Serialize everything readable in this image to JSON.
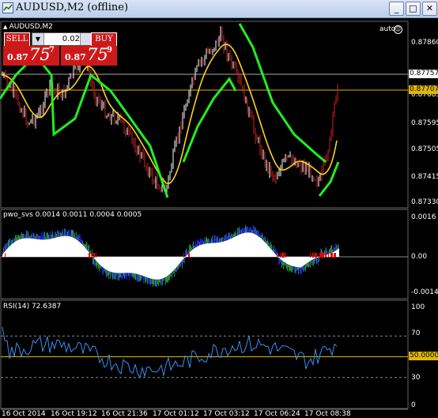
{
  "window": {
    "title": "AUDUSD,M2 (offline)",
    "buttons": [
      "_",
      "□",
      "✕"
    ]
  },
  "main_chart": {
    "symbol_label": "AUDUSD,M2",
    "auto_label": "auto",
    "price_axis": [
      "0.87860",
      "0.87685",
      "0.87595",
      "0.87505",
      "0.87415",
      "0.87330"
    ],
    "bid_line_label": "0.87757",
    "ask_line_label": "0.87707",
    "colors": {
      "bid_line": "#aaaaaa",
      "ask_line": "#e0b800",
      "candles_bull": "#ffffff",
      "candles_bear": "#cc2222",
      "ma_fast": "#ffd21f",
      "ma_slow": "#22ee22"
    }
  },
  "trade_panel": {
    "sell_label": "SELL",
    "buy_label": "BUY",
    "lot_value": "0.02",
    "sell_quote": {
      "prefix": "0.87",
      "big": "75",
      "sup": "7"
    },
    "buy_quote": {
      "prefix": "0.87",
      "big": "75",
      "sup": "9"
    }
  },
  "pwo_panel": {
    "label": "pwo_svs 0.0014 0.0011 0.0004 0.0005",
    "axis": [
      "0.0016",
      "0.00",
      "-0.0014"
    ],
    "colors": {
      "up": "#2a8a2a",
      "down": "#1a22dd",
      "red": "#ee0000",
      "white": "#ffffff"
    }
  },
  "rsi_panel": {
    "label": "RSI(14) 72.6387",
    "axis": [
      "100",
      "70",
      "50.0000",
      "30",
      "0"
    ],
    "levels": [
      70,
      50,
      30
    ],
    "colors": {
      "line": "#3a8ef0",
      "level50": "#e0b800"
    }
  },
  "time_axis": [
    "16 Oct 2014",
    "16 Oct 19:12",
    "16 Oct 21:36",
    "17 Oct 01:12",
    "17 Oct 03:12",
    "17 Oct 06:24",
    "17 Oct 08:38"
  ]
}
